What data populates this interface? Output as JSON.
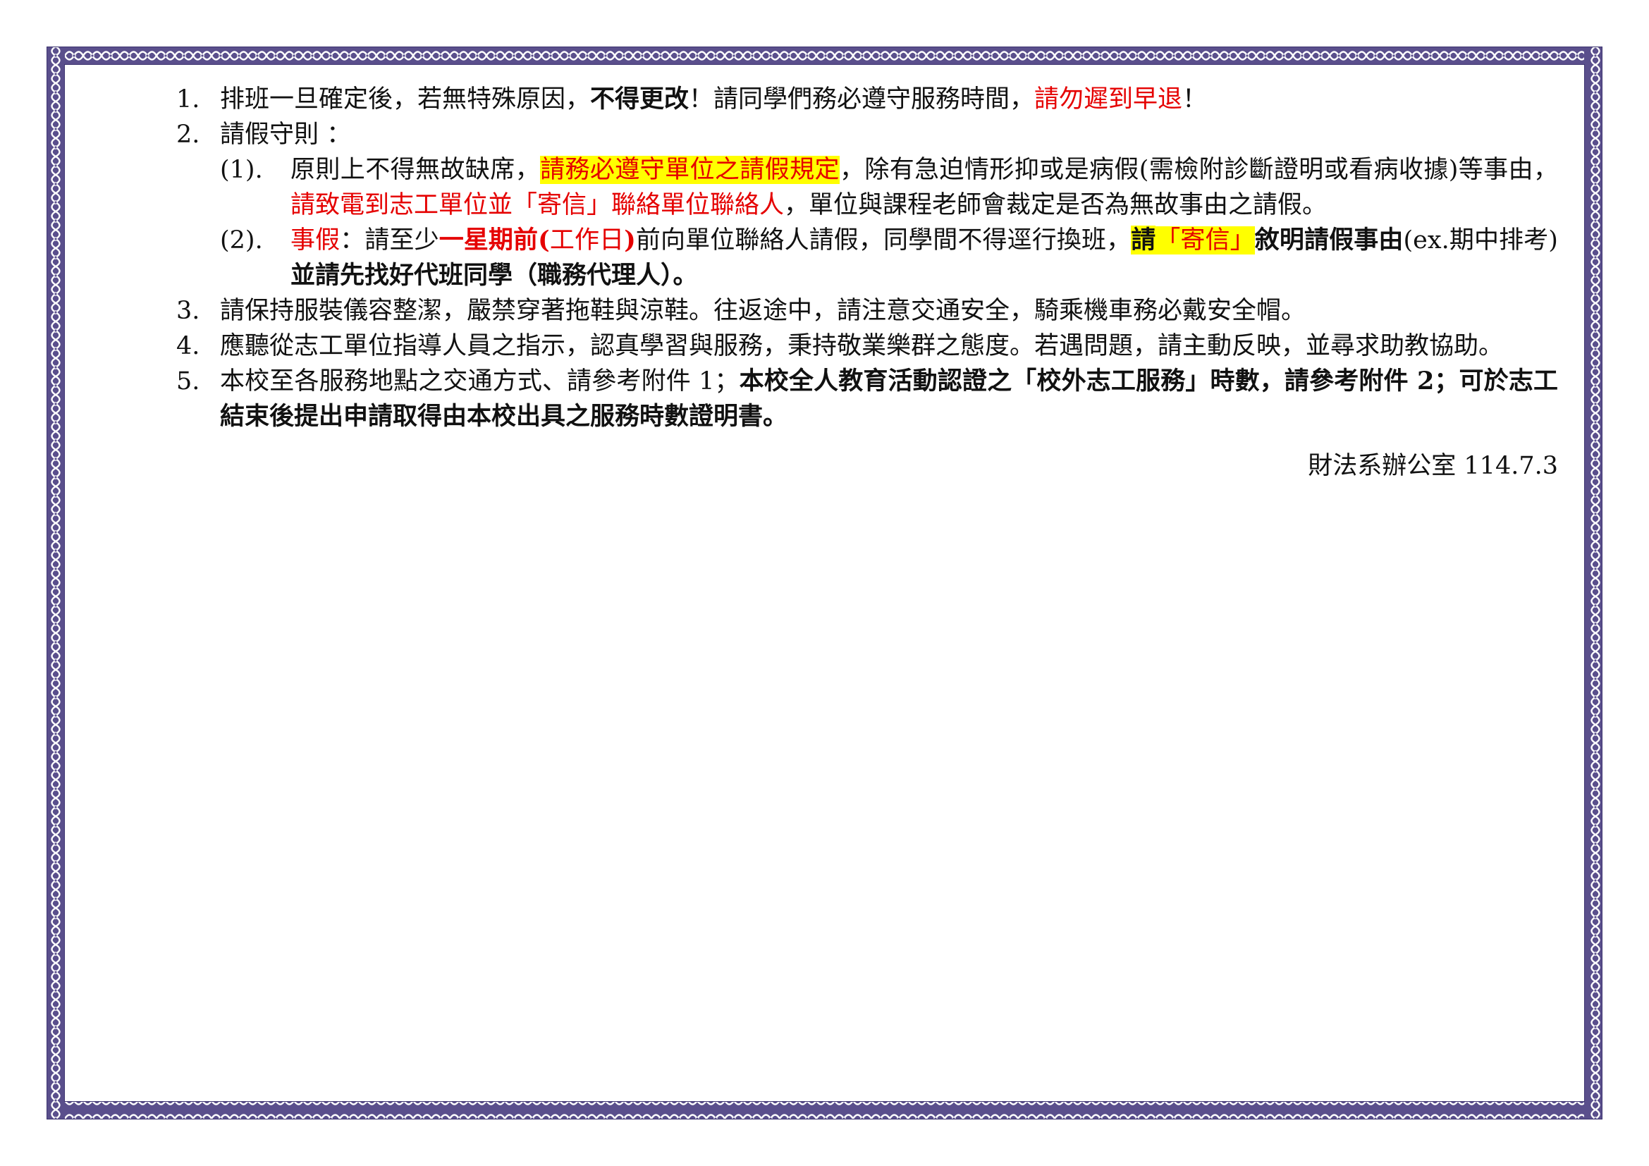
{
  "notice": {
    "item1": {
      "num": "1.",
      "t1": "排班一旦確定後，若無特殊原因，",
      "t2": "不得更改",
      "t3": "！請同學們務必遵守服務時間，",
      "t4": "請勿遲到早退",
      "t5": "！"
    },
    "item2": {
      "num": "2.",
      "title": "請假守則 ：",
      "sub1": {
        "num": "(1).",
        "t1": "原則上不得無故缺席，",
        "t2": "請務必遵守單位之請假規定",
        "t3": "，除有急迫情形抑或是病假(需檢附診斷證明或看病收據)等事由，",
        "t4": "請致電到志工單位並「寄信」聯絡單位聯絡人",
        "t5": "，單位與課程老師會裁定是否為無故事由之請假。"
      },
      "sub2": {
        "num": "(2).",
        "t1": "事假",
        "t2": "：請至少",
        "t3": "一星期前(",
        "t4": "工作日",
        "t5": ")",
        "t6": "前向單位聯絡人請假，同學間不得逕行換班，",
        "t7": "請",
        "t8": "「寄信」",
        "t9": "敘明請假事由",
        "t10": "(ex.期中排考)",
        "t11": "並請先找好代班同學（職務代理人）。"
      }
    },
    "item3": {
      "num": "3.",
      "text": "請保持服裝儀容整潔，嚴禁穿著拖鞋與涼鞋。往返途中，請注意交通安全，騎乘機車務必戴安全帽。"
    },
    "item4": {
      "num": "4.",
      "text": "應聽從志工單位指導人員之指示，認真學習與服務，秉持敬業樂群之態度。若遇問題，請主動反映，並尋求助教協助。"
    },
    "item5": {
      "num": "5.",
      "t1": "本校至各服務地點之交通方式、請參考附件 1；",
      "t2": "本校全人教育活動認證之「校外志工服務」時數，請參考附件 2；可於志工結束後提出申請取得由本校出具之服務時數證明書。"
    },
    "footer": "財法系辦公室  114.7.3"
  },
  "colors": {
    "border": "#5a4f8c",
    "red": "#e50000",
    "highlight": "#ffff00"
  }
}
